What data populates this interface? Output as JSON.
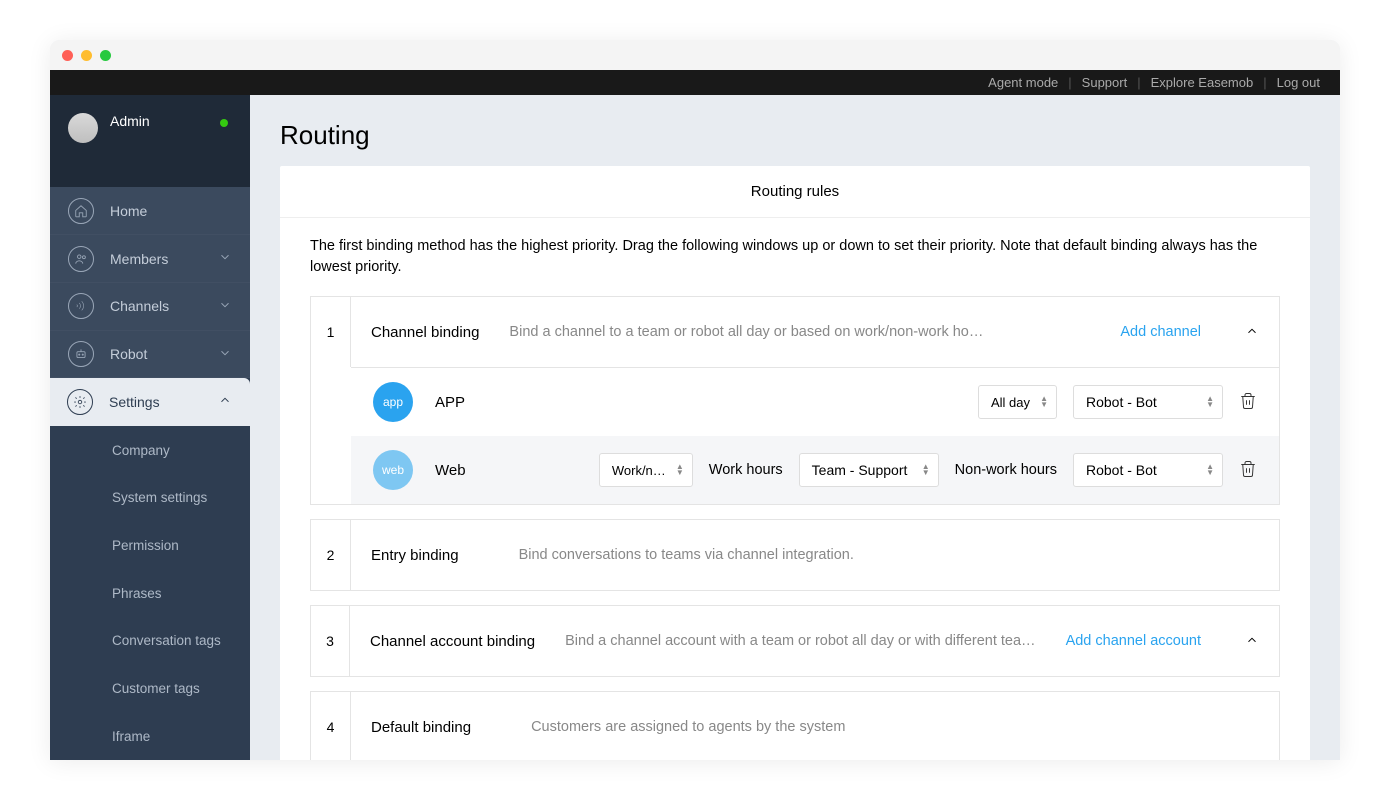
{
  "topbar": {
    "agent_mode": "Agent mode",
    "support": "Support",
    "explore": "Explore Easemob",
    "logout": "Log out"
  },
  "user": {
    "name": "Admin"
  },
  "nav": {
    "home": "Home",
    "members": "Members",
    "channels": "Channels",
    "robot": "Robot",
    "settings": "Settings",
    "sub": {
      "company": "Company",
      "system": "System settings",
      "permission": "Permission",
      "phrases": "Phrases",
      "conv_tags": "Conversation tags",
      "cust_tags": "Customer tags",
      "iframe": "Iframe"
    }
  },
  "page": {
    "title": "Routing",
    "panel_title": "Routing rules",
    "description": "The first binding method has the highest priority. Drag the following windows up or down to set their priority. Note that default binding always has the lowest priority."
  },
  "rules": [
    {
      "num": "1",
      "title": "Channel binding",
      "desc": "Bind a channel to a team or robot all day or based on work/non-work ho…",
      "action": "Add channel",
      "rows": [
        {
          "badge": "app",
          "badge_class": "blue",
          "name": "APP",
          "mode_sel": "All day",
          "target_sel": "Robot - Bot"
        },
        {
          "badge": "web",
          "badge_class": "light",
          "name": "Web",
          "mode_sel": "Work/n…",
          "work_label": "Work hours",
          "work_sel": "Team - Support",
          "nonwork_label": "Non-work hours",
          "nonwork_sel": "Robot - Bot"
        }
      ]
    },
    {
      "num": "2",
      "title": "Entry binding",
      "desc": "Bind conversations to teams via channel integration."
    },
    {
      "num": "3",
      "title": "Channel account binding",
      "desc": "Bind a channel account with a team or robot all day or with different tea…",
      "action": "Add channel account"
    },
    {
      "num": "4",
      "title": "Default binding",
      "desc": "Customers are assigned to agents by the system"
    }
  ]
}
